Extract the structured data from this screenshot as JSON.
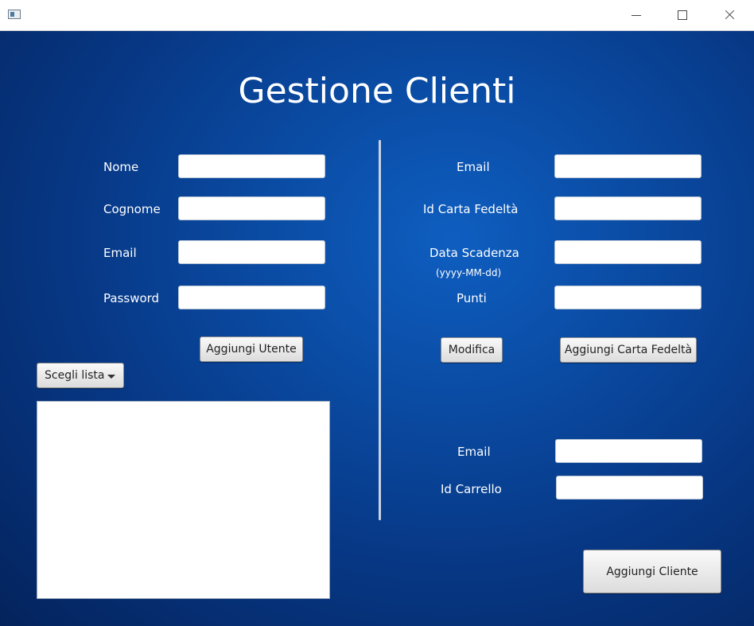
{
  "window": {
    "icon": "app-window-icon",
    "controls": [
      "minimize-icon",
      "maximize-icon",
      "close-icon"
    ]
  },
  "title": "Gestione Clienti",
  "user_form": {
    "nome_label": "Nome",
    "cognome_label": "Cognome",
    "email_label": "Email",
    "password_label": "Password",
    "nome_value": "",
    "cognome_value": "",
    "email_value": "",
    "password_value": "",
    "add_button": "Aggiungi Utente"
  },
  "list": {
    "selector_label": "Scegli lista",
    "items": []
  },
  "card_form": {
    "email_label": "Email",
    "id_card_label": "Id Carta Fedeltà",
    "expiry_label": "Data Scadenza",
    "expiry_hint": "(yyyy-MM-dd)",
    "points_label": "Punti",
    "email_value": "",
    "id_card_value": "",
    "expiry_value": "",
    "points_value": "",
    "modify_button": "Modifica",
    "add_card_button": "Aggiungi Carta Fedeltà"
  },
  "cart_form": {
    "email_label": "Email",
    "id_cart_label": "Id Carrello",
    "email_value": "",
    "id_cart_value": "",
    "add_client_button": "Aggiungi Cliente"
  }
}
